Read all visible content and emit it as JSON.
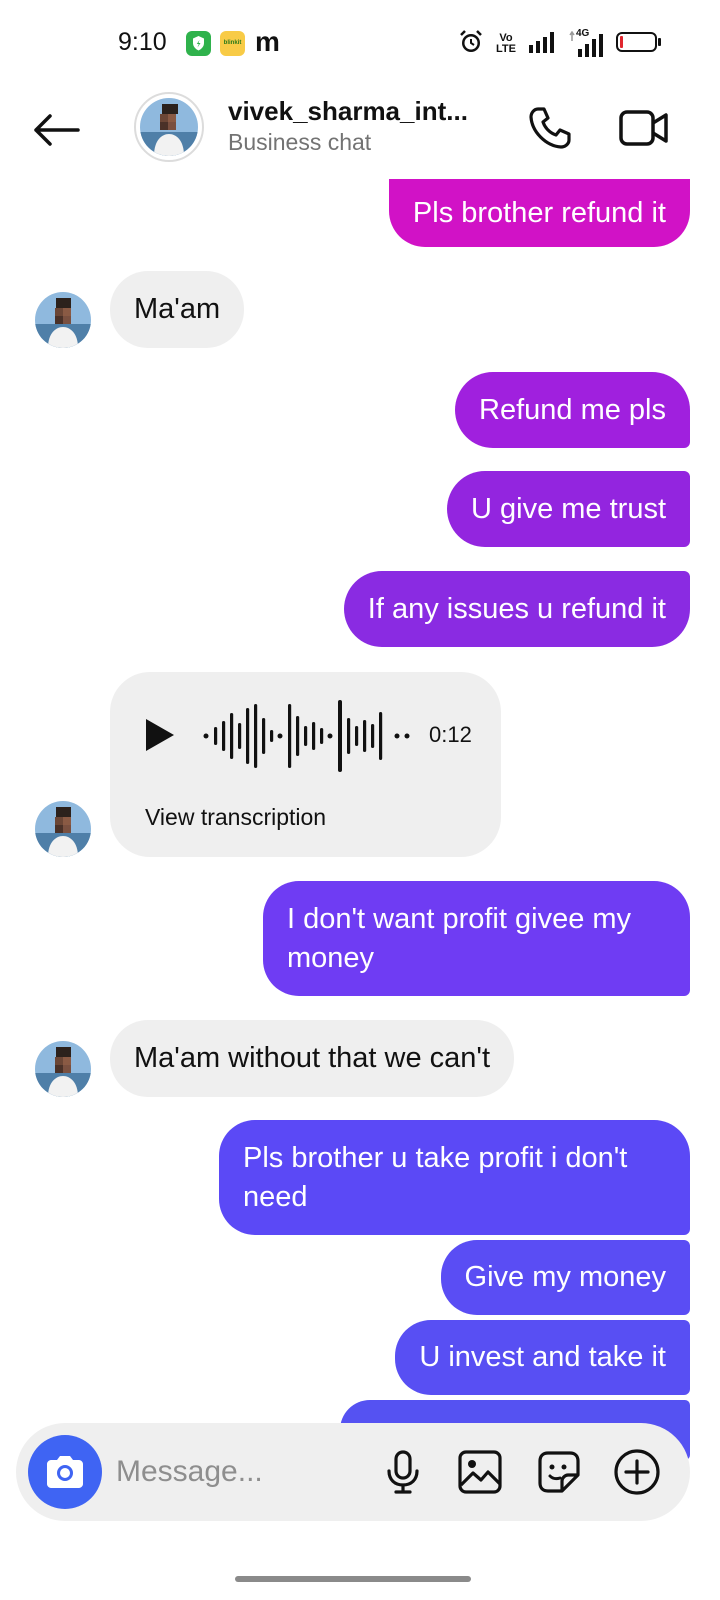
{
  "status_bar": {
    "time": "9:10",
    "icons": [
      "vpn-shield-icon",
      "blinkit-app-icon",
      "m-app-icon",
      "alarm-icon",
      "volte-icon",
      "signal-icon",
      "4g-signal-icon",
      "battery-low-icon"
    ],
    "blinkit_label": "blinkit",
    "m_label": "m",
    "volte_label": "Vo LTE",
    "net_label": "4G"
  },
  "header": {
    "contact_name": "vivek_sharma_int...",
    "subtitle": "Business chat"
  },
  "theme": {
    "outgoing_colors": [
      "#d112c6",
      "#a020de",
      "#9325df",
      "#8a2be2",
      "#6f3cf3",
      "#5b49f6",
      "#5a4df4",
      "#584ff3",
      "#5552f2"
    ],
    "incoming_color": "#efefef",
    "camera_button_color": "#3f64f3"
  },
  "messages": [
    {
      "direction": "out",
      "text": "Pls brother refund it"
    },
    {
      "direction": "in",
      "text": "Ma'am"
    },
    {
      "direction": "out",
      "text": "Refund me pls"
    },
    {
      "direction": "out",
      "text": "U give me trust"
    },
    {
      "direction": "out",
      "text": "If any issues u refund it"
    },
    {
      "direction": "in",
      "type": "voice",
      "duration": "0:12",
      "transcription_label": "View transcription"
    },
    {
      "direction": "out",
      "text": "I don't want profit givee my money"
    },
    {
      "direction": "in",
      "text": "Ma'am without that we can't"
    },
    {
      "direction": "out",
      "text": "Pls brother u take profit i don't need"
    },
    {
      "direction": "out",
      "text": "Give my money"
    },
    {
      "direction": "out",
      "text": "U invest and take it"
    }
  ],
  "composer": {
    "placeholder": "Message...",
    "buttons": [
      "camera-icon",
      "microphone-icon",
      "gallery-icon",
      "sticker-icon",
      "add-icon"
    ]
  }
}
